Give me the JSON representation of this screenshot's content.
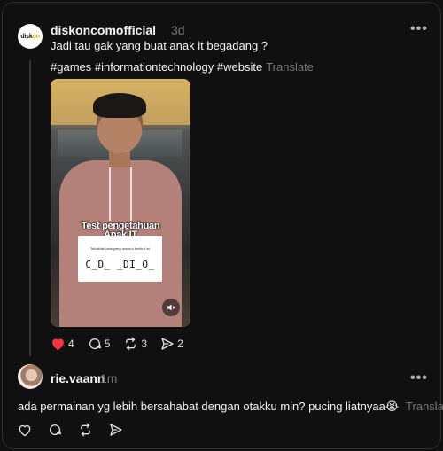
{
  "post": {
    "author": "diskoncomofficial",
    "avatar_text_a": "disk",
    "avatar_text_b": "on",
    "time": "3d",
    "more": "•••",
    "text": "Jadi tau gak yang buat anak it begadang ?",
    "hashtags": "#games #informationtechnology #website",
    "translate": "Translate",
    "media": {
      "quiz_title_line1": "Test pengetahuan",
      "quiz_title_line2": "Anak IT",
      "quiz_hint": "Tebaklah kata yang muncul berikut ini",
      "quiz_word": "C_D_ _DI_O_"
    },
    "actions": {
      "likes": "4",
      "comments": "5",
      "reposts": "3",
      "shares": "2",
      "like_color": "#ff3040"
    }
  },
  "reply": {
    "author": "rie.vaann",
    "time": "1m",
    "more": "•••",
    "text": "ada permainan yg lebih bersahabat dengan otakku min? pucing liatnyaa😭",
    "translate": "Translate"
  }
}
